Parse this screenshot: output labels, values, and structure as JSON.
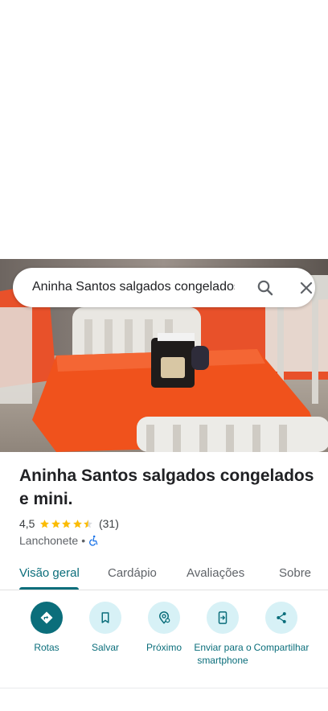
{
  "search": {
    "query": "Aninha Santos salgados congelados"
  },
  "place": {
    "name": "Aninha Santos salgados congelados e mini.",
    "rating": "4,5",
    "rating_value": 4.5,
    "review_count": "(31)",
    "category": "Lanchonete",
    "separator": "•"
  },
  "tabs": [
    {
      "label": "Visão geral",
      "active": true
    },
    {
      "label": "Cardápio",
      "active": false
    },
    {
      "label": "Avaliações",
      "active": false
    },
    {
      "label": "Sobre",
      "active": false
    }
  ],
  "actions": [
    {
      "label": "Rotas",
      "icon": "directions-icon"
    },
    {
      "label": "Salvar",
      "icon": "bookmark-icon"
    },
    {
      "label": "Próximo",
      "icon": "nearby-icon"
    },
    {
      "label": "Enviar para o smartphone",
      "icon": "send-to-phone-icon"
    },
    {
      "label": "Compartilhar",
      "icon": "share-icon"
    }
  ],
  "colors": {
    "accent": "#0b6e7b",
    "accent_light": "#d7f1f6",
    "star": "#fbbc04",
    "tablecloth": "#f0521c",
    "accessibility": "#1a73e8"
  }
}
